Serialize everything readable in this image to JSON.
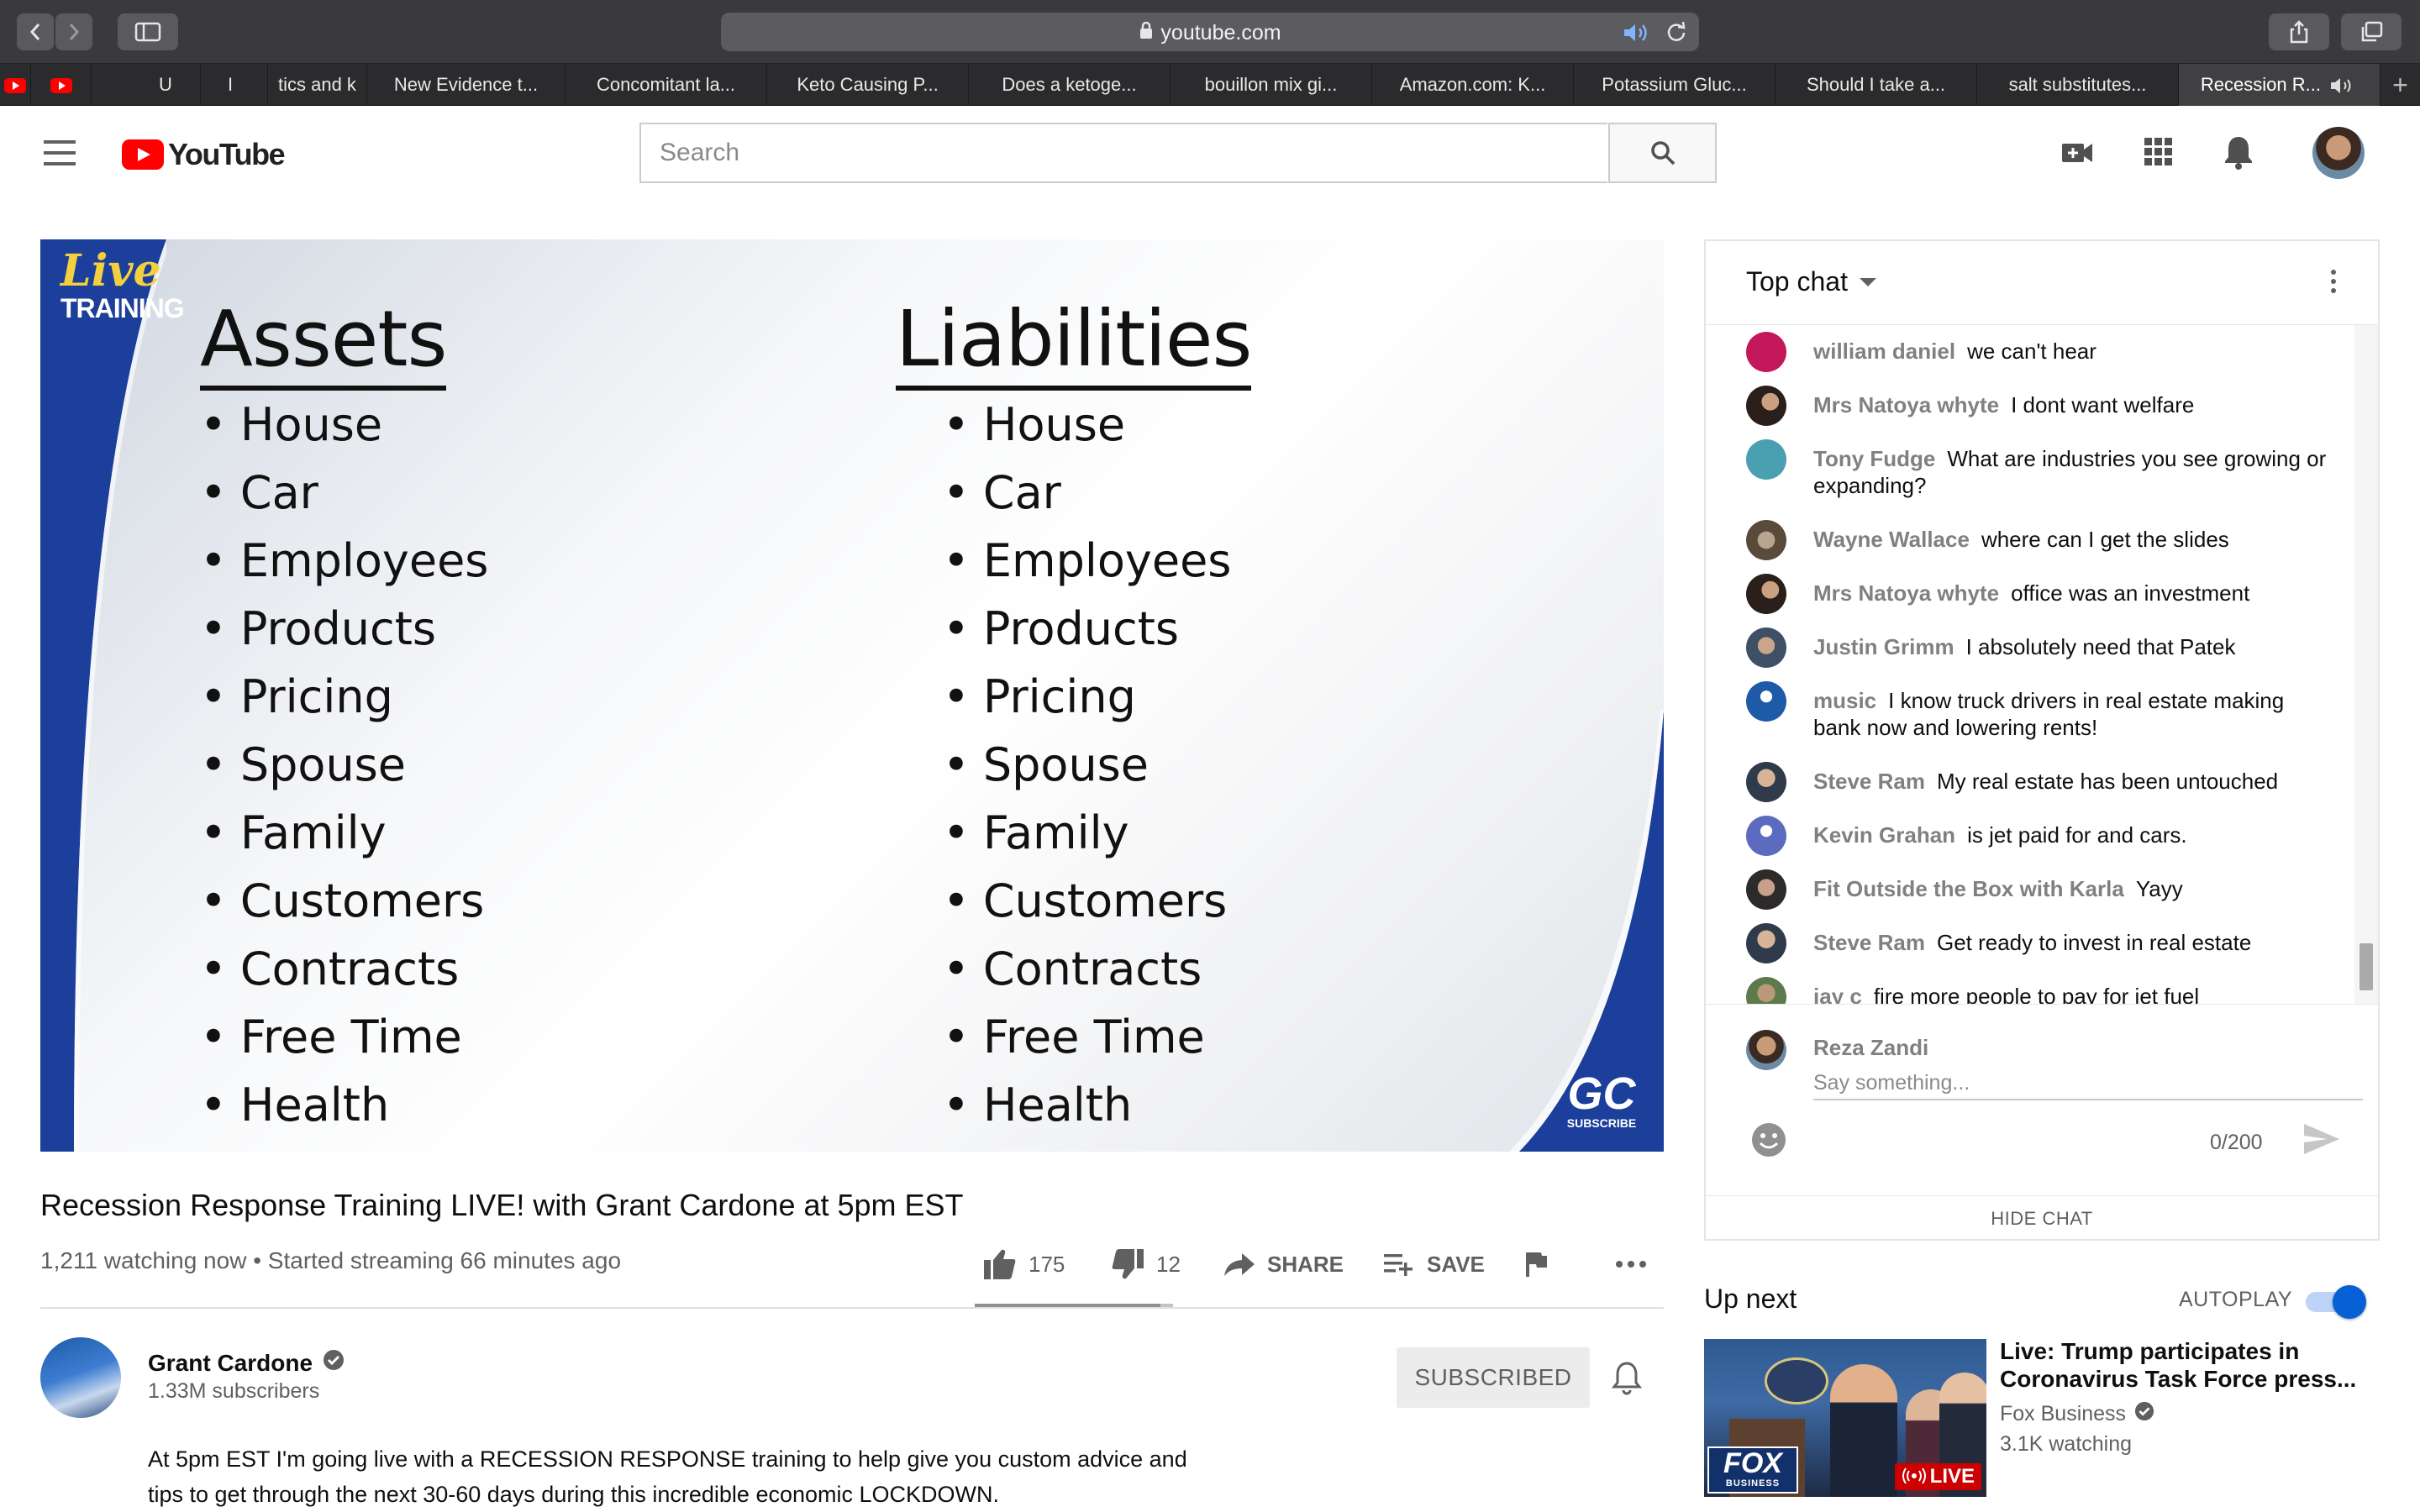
{
  "browser": {
    "url": "youtube.com",
    "tabs": [
      {
        "label": ""
      },
      {
        "label": ""
      },
      {
        "label": "U"
      },
      {
        "label": "I"
      },
      {
        "label": "tics and k"
      },
      {
        "label": "New Evidence t..."
      },
      {
        "label": "Concomitant la..."
      },
      {
        "label": "Keto Causing P..."
      },
      {
        "label": "Does a ketoge..."
      },
      {
        "label": "bouillon mix gi..."
      },
      {
        "label": "Amazon.com: K..."
      },
      {
        "label": "Potassium Gluc..."
      },
      {
        "label": "Should I take a..."
      },
      {
        "label": "salt substitutes..."
      },
      {
        "label": "Recession R..."
      }
    ],
    "new_tab": "+"
  },
  "header": {
    "logo_text": "YouTube",
    "search_placeholder": "Search"
  },
  "video": {
    "badge_line1": "Live",
    "badge_line2": "TRAINING",
    "slide": {
      "left_title": "Assets",
      "right_title": "Liabilities",
      "left_items": [
        "House",
        "Car",
        "Employees",
        "Products",
        "Pricing",
        "Spouse",
        "Family",
        "Customers",
        "Contracts",
        "Free Time",
        "Health"
      ],
      "right_items": [
        "House",
        "Car",
        "Employees",
        "Products",
        "Pricing",
        "Spouse",
        "Family",
        "Customers",
        "Contracts",
        "Free Time",
        "Health"
      ]
    },
    "watermark_logo": "GC",
    "watermark_sub": "SUBSCRIBE",
    "title": "Recession Response Training LIVE! with Grant Cardone at 5pm EST",
    "view_info": "1,211 watching now • Started streaming 66 minutes ago",
    "likes": "175",
    "dislikes": "12",
    "like_ratio": 0.936,
    "share_label": "SHARE",
    "save_label": "SAVE"
  },
  "channel": {
    "name": "Grant Cardone",
    "subscribers": "1.33M subscribers",
    "subscribed_label": "SUBSCRIBED",
    "description": "At 5pm EST I'm going live with a RECESSION RESPONSE training to help give you custom advice and tips to get through the next 30-60 days during this incredible economic LOCKDOWN."
  },
  "chat": {
    "mode": "Top chat",
    "messages": [
      {
        "author": "william daniel",
        "text": "we can't hear",
        "color": "#c2185b"
      },
      {
        "author": "Mrs Natoya whyte",
        "text": "I dont want welfare",
        "color": "#3a2a20"
      },
      {
        "author": "Tony Fudge",
        "text": "What are industries you see growing or expanding?",
        "color": "#4aa0b0"
      },
      {
        "author": "Wayne Wallace",
        "text": "where can I get the slides",
        "color": "#6d5a4a"
      },
      {
        "author": "Mrs Natoya whyte",
        "text": "office was an investment",
        "color": "#3a2a20"
      },
      {
        "author": "Justin Grimm",
        "text": "I absolutely need that Patek",
        "color": "#5a6a80"
      },
      {
        "author": "music",
        "text": "I know truck drivers in real estate making bank now and lowering rents!",
        "color": "#1e5aa8"
      },
      {
        "author": "Steve Ram",
        "text": "My real estate has been untouched",
        "color": "#4a5a6a"
      },
      {
        "author": "Kevin Grahan",
        "text": "is jet paid for and cars.",
        "color": "#5c6bc0"
      },
      {
        "author": "Fit Outside the Box with Karla",
        "text": "Yayy",
        "color": "#2d2a2a"
      },
      {
        "author": "Steve Ram",
        "text": "Get ready to invest in real estate",
        "color": "#4a5a6a"
      },
      {
        "author": "jay c",
        "text": "fire more people to pay for jet fuel",
        "color": "#5d7a4a"
      }
    ],
    "current_user": "Reza Zandi",
    "input_placeholder": "Say something...",
    "char_count": "0/200",
    "hide_chat": "HIDE CHAT"
  },
  "up_next": {
    "label": "Up next",
    "autoplay_label": "AUTOPLAY",
    "autoplay_on": true,
    "title": "Live: Trump participates in Coronavirus Task Force press...",
    "channel": "Fox Business",
    "views": "3.1K watching",
    "live_badge": "LIVE",
    "thumb_logo": "FOX",
    "thumb_logo_sub": "BUSINESS"
  },
  "colors": {
    "brand_red": "#ff0000",
    "accent_blue": "#065fd4",
    "slide_blue": "#1c3f9b"
  }
}
